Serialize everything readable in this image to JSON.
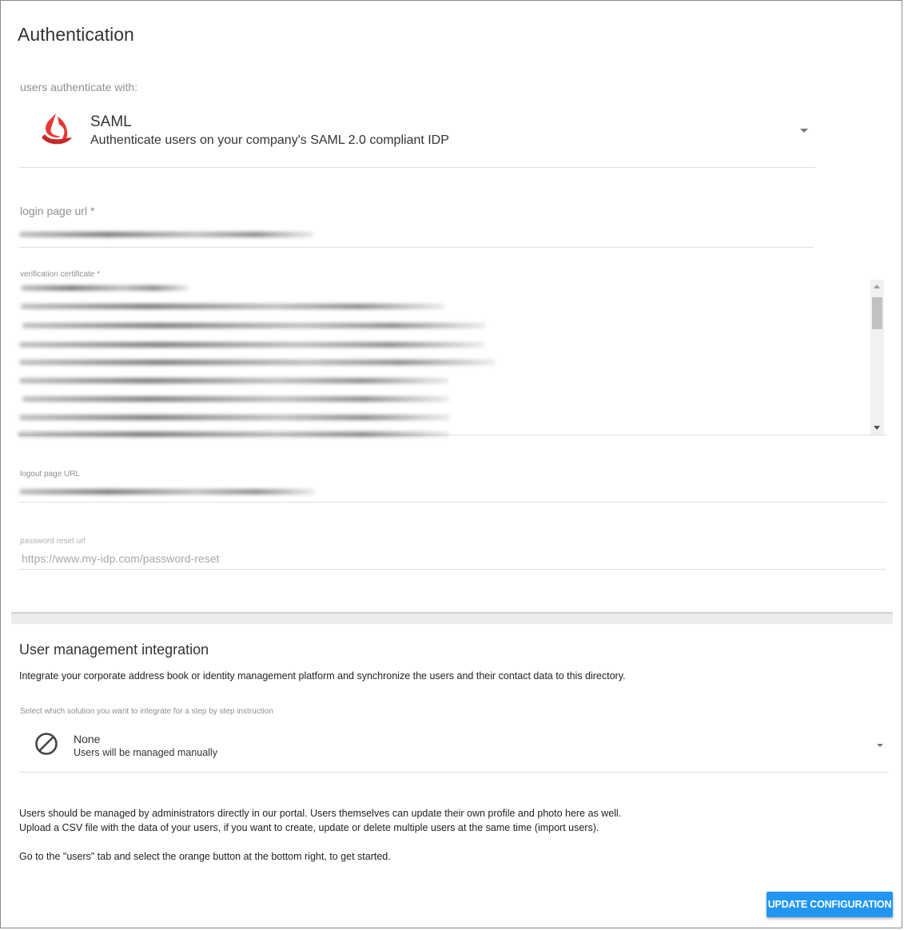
{
  "authentication": {
    "title": "Authentication",
    "users_authenticate_label": "users authenticate with:",
    "method": {
      "name": "SAML",
      "description": "Authenticate users on your company's SAML 2.0 compliant IDP",
      "icon": "saml-logo-icon"
    },
    "login_page_url": {
      "label": "login page url *"
    },
    "verification_certificate": {
      "label": "verification certificate *"
    },
    "logout_page_url": {
      "label": "logout page URL"
    },
    "password_reset_url": {
      "label": "password reset url",
      "placeholder": "https://www.my-idp.com/password-reset"
    }
  },
  "user_management": {
    "title": "User management integration",
    "intro": "Integrate your corporate address book or identity management platform and synchronize the users and their contact data to this directory.",
    "select_label": "Select which solution you want to integrate for a step by step instruction",
    "selected": {
      "name": "None",
      "description": "Users will be managed manually",
      "icon": "prohibited-icon"
    },
    "info_line1": "Users should be managed by administrators directly in our portal. Users themselves can update their own profile and photo here as well.",
    "info_line2": "Upload a CSV file with the data of your users, if you want to create, update or delete multiple users at the same time (import users).",
    "info_line3": "Go to the \"users\" tab and select the orange button at the bottom right, to get started."
  },
  "actions": {
    "update_label": "UPDATE CONFIGURATION"
  },
  "colors": {
    "primary_button": "#2196f3",
    "saml_logo": "#e53935"
  }
}
